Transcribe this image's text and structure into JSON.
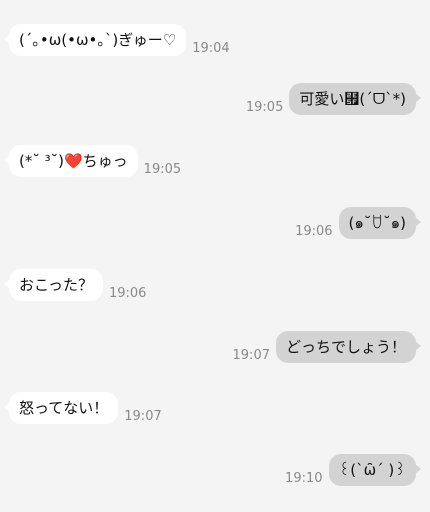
{
  "messages": [
    {
      "direction": "incoming",
      "text": "(´｡•ω(•ω•｡`)ぎゅー♡",
      "time": "19:04"
    },
    {
      "direction": "outgoing",
      "text": "可愛い⹟(´ᗜ`*)",
      "time": "19:05"
    },
    {
      "direction": "incoming",
      "text": "(*˘ ³˘)❤️ちゅっ",
      "time": "19:05"
    },
    {
      "direction": "outgoing",
      "text": "(๑˘ꇴ˘๑)",
      "time": "19:06"
    },
    {
      "direction": "incoming",
      "text": "おこった？",
      "time": "19:06"
    },
    {
      "direction": "outgoing",
      "text": "どっちでしょう！",
      "time": "19:07"
    },
    {
      "direction": "incoming",
      "text": "怒ってない！",
      "time": "19:07"
    },
    {
      "direction": "outgoing",
      "text": "꒰(`ω̑´ )꒱",
      "time": "19:10"
    }
  ]
}
